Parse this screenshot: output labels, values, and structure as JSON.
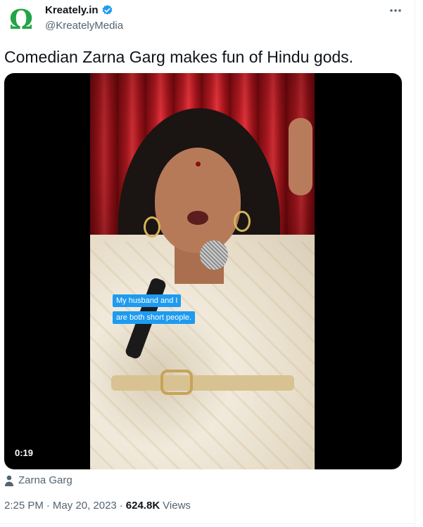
{
  "author": {
    "display_name": "Kreately.in",
    "handle": "@KreatelyMedia",
    "avatar_glyph": "Ω",
    "avatar_color": "#22a447",
    "verified_color": "#1d9bf0"
  },
  "tweet": {
    "text": "Comedian Zarna Garg makes fun of Hindu gods."
  },
  "media": {
    "duration": "0:19",
    "caption_lines": [
      "My husband and I",
      "are both short people."
    ]
  },
  "attribution": {
    "name": "Zarna Garg"
  },
  "meta": {
    "time": "2:25 PM",
    "separator": "·",
    "date": "May 20, 2023",
    "views_count": "624.8K",
    "views_label": "Views"
  }
}
